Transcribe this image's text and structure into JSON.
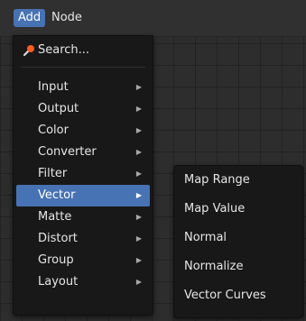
{
  "header": {
    "add_label": "Add",
    "node_label": "Node"
  },
  "search": {
    "label": "Search..."
  },
  "add_menu": {
    "items": [
      {
        "label": "Input"
      },
      {
        "label": "Output"
      },
      {
        "label": "Color"
      },
      {
        "label": "Converter"
      },
      {
        "label": "Filter"
      },
      {
        "label": "Vector"
      },
      {
        "label": "Matte"
      },
      {
        "label": "Distort"
      },
      {
        "label": "Group"
      },
      {
        "label": "Layout"
      }
    ],
    "highlighted": "Vector"
  },
  "vector_submenu": {
    "items": [
      {
        "label": "Map Range"
      },
      {
        "label": "Map Value"
      },
      {
        "label": "Normal"
      },
      {
        "label": "Normalize"
      },
      {
        "label": "Vector Curves"
      }
    ]
  },
  "icons": {
    "search": "search-icon",
    "submenu_arrow": "submenu-arrow-icon"
  },
  "colors": {
    "highlight": "#4772b3",
    "menu_background": "#181818",
    "header_background": "#303030",
    "canvas_background": "#2d2d2d",
    "search_icon_accent": "#ff5c1f"
  }
}
